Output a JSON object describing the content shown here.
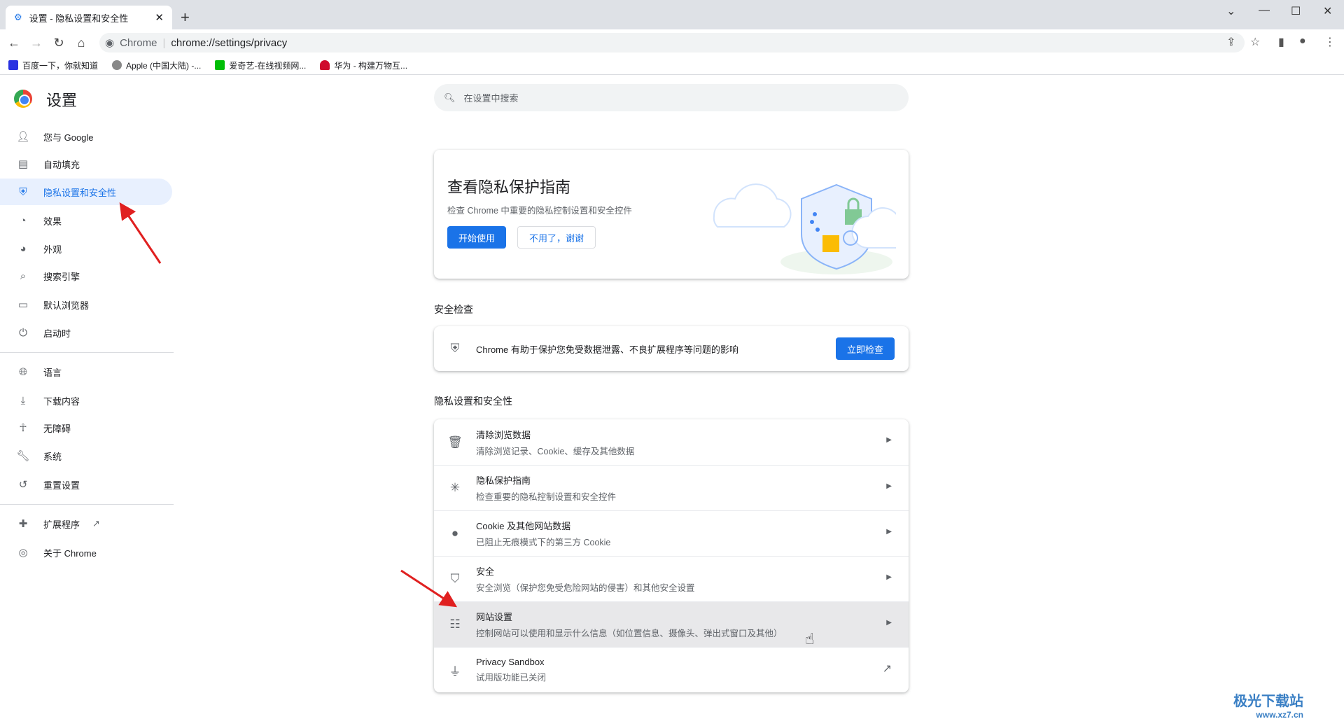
{
  "browser": {
    "tab_title": "设置 - 隐私设置和安全性",
    "omnibox_label": "Chrome",
    "url": "chrome://settings/privacy",
    "bookmarks": [
      "百度一下，你就知道",
      "Apple (中国大陆) -...",
      "爱奇艺-在线视频网...",
      "华为 - 构建万物互..."
    ]
  },
  "header": {
    "title": "设置",
    "search_placeholder": "在设置中搜索"
  },
  "sidebar": {
    "items": [
      {
        "label": "您与 Google",
        "icon": "person-icon"
      },
      {
        "label": "自动填充",
        "icon": "clipboard-icon"
      },
      {
        "label": "隐私设置和安全性",
        "icon": "shield-icon",
        "selected": true
      },
      {
        "label": "效果",
        "icon": "speedometer-icon"
      },
      {
        "label": "外观",
        "icon": "palette-icon"
      },
      {
        "label": "搜索引擎",
        "icon": "search-icon"
      },
      {
        "label": "默认浏览器",
        "icon": "browser-icon"
      },
      {
        "label": "启动时",
        "icon": "power-icon"
      },
      {
        "label": "语言",
        "icon": "globe-icon"
      },
      {
        "label": "下载内容",
        "icon": "download-icon"
      },
      {
        "label": "无障碍",
        "icon": "accessibility-icon"
      },
      {
        "label": "系统",
        "icon": "wrench-icon"
      },
      {
        "label": "重置设置",
        "icon": "restore-icon"
      },
      {
        "label": "扩展程序",
        "icon": "puzzle-icon"
      },
      {
        "label": "关于 Chrome",
        "icon": "chrome-icon"
      }
    ]
  },
  "guide_card": {
    "title": "查看隐私保护指南",
    "subtitle": "检查 Chrome 中重要的隐私控制设置和安全控件",
    "start": "开始使用",
    "dismiss": "不用了，谢谢"
  },
  "safety": {
    "heading": "安全检查",
    "text": "Chrome 有助于保护您免受数据泄露、不良扩展程序等问题的影响",
    "button": "立即检查"
  },
  "privacy": {
    "heading": "隐私设置和安全性",
    "rows": [
      {
        "title": "清除浏览数据",
        "desc": "清除浏览记录、Cookie、缓存及其他数据",
        "icon": "trash-icon"
      },
      {
        "title": "隐私保护指南",
        "desc": "检查重要的隐私控制设置和安全控件",
        "icon": "guide-icon"
      },
      {
        "title": "Cookie 及其他网站数据",
        "desc": "已阻止无痕模式下的第三方 Cookie",
        "icon": "cookie-icon"
      },
      {
        "title": "安全",
        "desc": "安全浏览（保护您免受危险网站的侵害）和其他安全设置",
        "icon": "security-shield-icon"
      },
      {
        "title": "网站设置",
        "desc": "控制网站可以使用和显示什么信息（如位置信息、摄像头、弹出式窗口及其他）",
        "icon": "tune-icon"
      },
      {
        "title": "Privacy Sandbox",
        "desc": "试用版功能已关闭",
        "icon": "flask-icon"
      }
    ]
  },
  "watermark": {
    "text": "极光下载站",
    "url": "www.xz7.cn"
  },
  "colors": {
    "accent": "#1a73e8",
    "annotation": "#e02020"
  }
}
